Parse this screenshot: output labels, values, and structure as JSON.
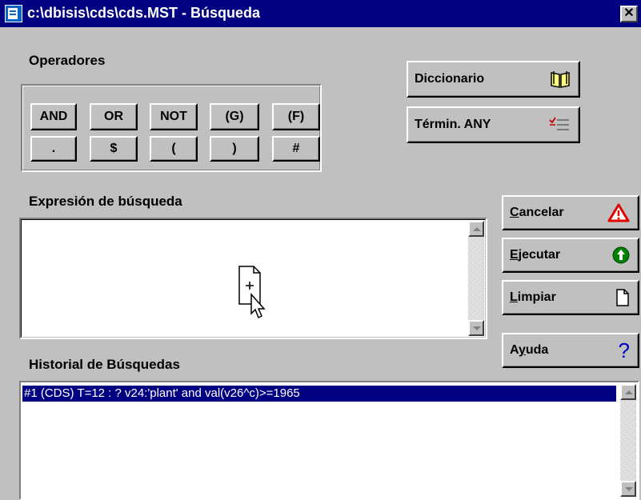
{
  "window": {
    "title": "c:\\dbisis\\cds\\cds.MST - Búsqueda",
    "close_glyph": "✕"
  },
  "operators": {
    "label": "Operadores",
    "row1": [
      "AND",
      "OR",
      "NOT",
      "(G)",
      "(F)"
    ],
    "row2": [
      ".",
      "$",
      "(",
      ")",
      "#"
    ]
  },
  "side_buttons": {
    "diccionario": "Diccionario",
    "termin_any": "Términ. ANY"
  },
  "expression": {
    "label": "Expresión de búsqueda",
    "value": ""
  },
  "actions": {
    "cancelar": {
      "first": "C",
      "rest": "ancelar"
    },
    "ejecutar": {
      "first": "E",
      "rest": "jecutar"
    },
    "limpiar": {
      "first": "L",
      "rest": "impiar"
    },
    "ayuda": {
      "pre": "A",
      "u": "y",
      "post": "uda"
    },
    "help_glyph": "?"
  },
  "history": {
    "label": "Historial de Búsquedas",
    "items": [
      "#1 (CDS) T=12 : ? v24:'plant' and val(v26^c)>=1965"
    ]
  },
  "icons": [
    "app-icon",
    "book-icon",
    "checklist-icon",
    "warning-icon",
    "go-icon",
    "page-icon",
    "help-icon",
    "drag-document-cursor-icon"
  ],
  "colors": {
    "titlebar": "#000080",
    "face": "#c0c0c0",
    "selection": "#000080",
    "warning": "#e00000",
    "go": "#008000",
    "help": "#0000c0"
  }
}
